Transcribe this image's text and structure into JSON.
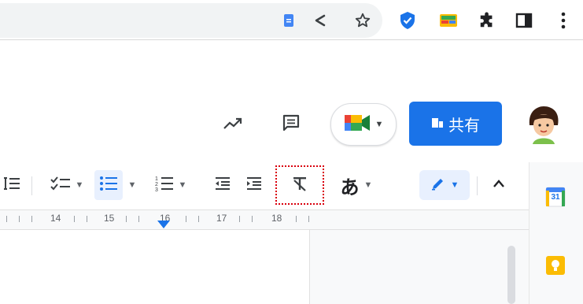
{
  "browser": {
    "toolbar_icons": [
      "docs-tab-icon",
      "share-icon",
      "star-icon",
      "shield-icon",
      "extension-card-icon",
      "puzzle-icon",
      "side-panel-icon",
      "more-vert-icon"
    ]
  },
  "doc_header": {
    "activity_icon": "trending-icon",
    "comment_icon": "comment-icon",
    "share_label": "共有"
  },
  "toolbar": {
    "input_tools_label": "あ",
    "items": [
      "line-spacing",
      "checklist",
      "bulleted-list",
      "numbered-list",
      "decrease-indent",
      "increase-indent",
      "clear-formatting",
      "input-tools",
      "editing-mode",
      "collapse-menu"
    ]
  },
  "ruler": {
    "labels": [
      "14",
      "15",
      "16",
      "17",
      "18"
    ]
  },
  "side_panel": {
    "calendar_label": "31"
  },
  "colors": {
    "share_button": "#1a73e8",
    "highlight_frame": "#d9000d",
    "active_button_bg": "#e8f0fe"
  }
}
